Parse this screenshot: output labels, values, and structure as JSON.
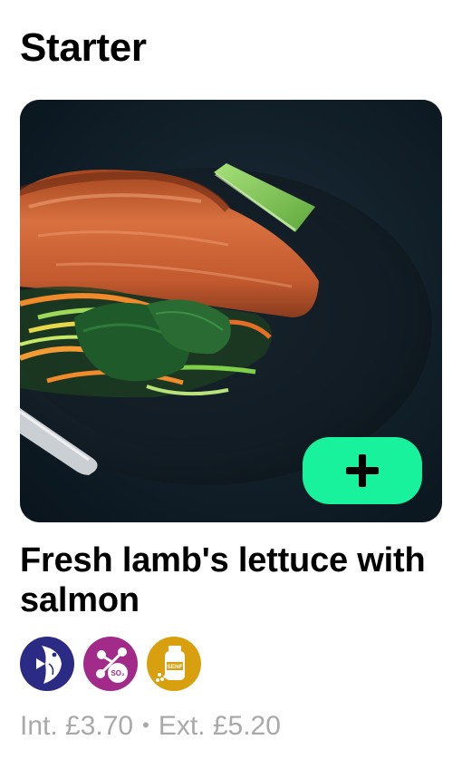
{
  "section": {
    "title": "Starter"
  },
  "item": {
    "image_icon": "salmon-dish-photo",
    "add_button": {
      "icon": "plus-icon",
      "color": "#18f29c"
    },
    "name": "Fresh lamb's lettuce with salmon",
    "allergens": [
      {
        "name": "fish",
        "icon": "fish-icon",
        "color": "#2b2a85"
      },
      {
        "name": "sulphites",
        "icon": "sulphites-icon",
        "color": "#a22a88",
        "label": "SO2"
      },
      {
        "name": "mustard",
        "icon": "mustard-icon",
        "color": "#d8a00f",
        "label": "SENF"
      }
    ],
    "price": {
      "internal": "Int. £3.70",
      "separator": "•",
      "external": "Ext. £5.20"
    }
  }
}
